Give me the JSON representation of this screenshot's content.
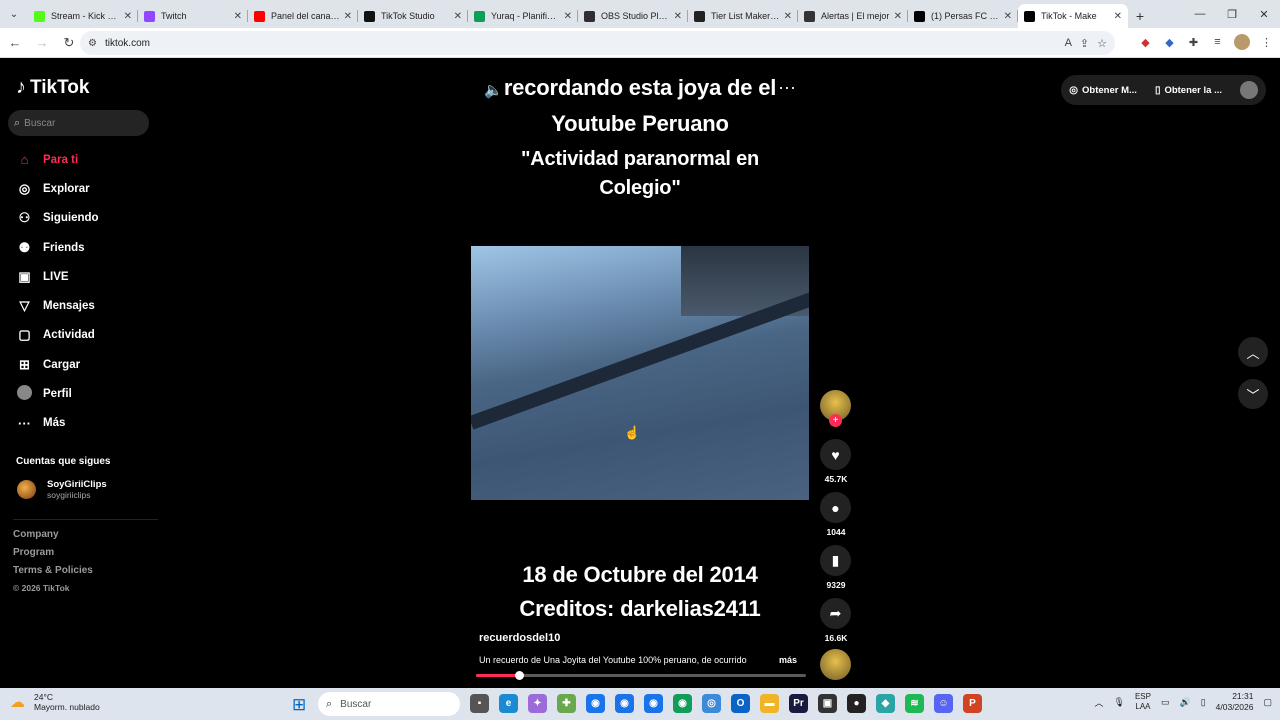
{
  "browser": {
    "tabs": [
      {
        "label": "Stream - Kick Dashboard",
        "color": "#53fc18"
      },
      {
        "label": "Twitch",
        "color": "#9146ff"
      },
      {
        "label": "Panel del canal - YouTube",
        "color": "#ff0000"
      },
      {
        "label": "TikTok Studio",
        "color": "#111111"
      },
      {
        "label": "Yuraq - Planificador",
        "color": "#0f9d58"
      },
      {
        "label": "OBS Studio Plugins",
        "color": "#302e31"
      },
      {
        "label": "Tier List Maker for",
        "color": "#222222"
      },
      {
        "label": "Alertas | El mejor",
        "color": "#333333"
      },
      {
        "label": "(1) Persas FC (@P",
        "color": "#000000"
      },
      {
        "label": "TikTok - Make",
        "color": "#000000",
        "active": true
      }
    ],
    "url": "tiktok.com"
  },
  "tiktok": {
    "logo": "TikTok",
    "search_placeholder": "Buscar",
    "nav": [
      {
        "label": "Para ti",
        "icon": "home-icon",
        "active": true
      },
      {
        "label": "Explorar",
        "icon": "compass-icon"
      },
      {
        "label": "Siguiendo",
        "icon": "following-icon"
      },
      {
        "label": "Friends",
        "icon": "friends-icon"
      },
      {
        "label": "LIVE",
        "icon": "live-icon"
      },
      {
        "label": "Mensajes",
        "icon": "message-icon"
      },
      {
        "label": "Actividad",
        "icon": "activity-icon"
      },
      {
        "label": "Cargar",
        "icon": "upload-icon"
      },
      {
        "label": "Perfil",
        "icon": "profile-avatar"
      },
      {
        "label": "Más",
        "icon": "more-icon"
      }
    ],
    "following_title": "Cuentas que sigues",
    "following": [
      {
        "name": "SoyGiriiClips",
        "handle": "soygiriiclips"
      }
    ],
    "footer": {
      "company": "Company",
      "program": "Program",
      "terms": "Terms & Policies",
      "copyright": "© 2026 TikTok"
    },
    "topright": {
      "get_coins": "Obtener M...",
      "get_app": "Obtener la ..."
    },
    "video": {
      "caption_line1": "recordando esta joya de el",
      "caption_line2": "Youtube Peruano",
      "caption_line3": "\"Actividad paranormal en",
      "caption_line4": "Colegio\"",
      "caption_line5": "18 de Octubre del 2014",
      "caption_line6": "Creditos: darkelias2411",
      "author": "recuerdosdel10",
      "description": "Un recuerdo de Una Joyita del Youtube 100% peruano, de ocurrido",
      "more": "más",
      "progress_fraction": 0.13
    },
    "actions": {
      "likes": "45.7K",
      "comments": "1044",
      "saves": "9329",
      "shares": "16.6K"
    }
  },
  "taskbar": {
    "temp": "24°C",
    "weather": "Mayorm. nublado",
    "search": "Buscar",
    "lang1": "ESP",
    "lang2": "LAA",
    "time": "21:31",
    "date": "4/03/2026"
  }
}
